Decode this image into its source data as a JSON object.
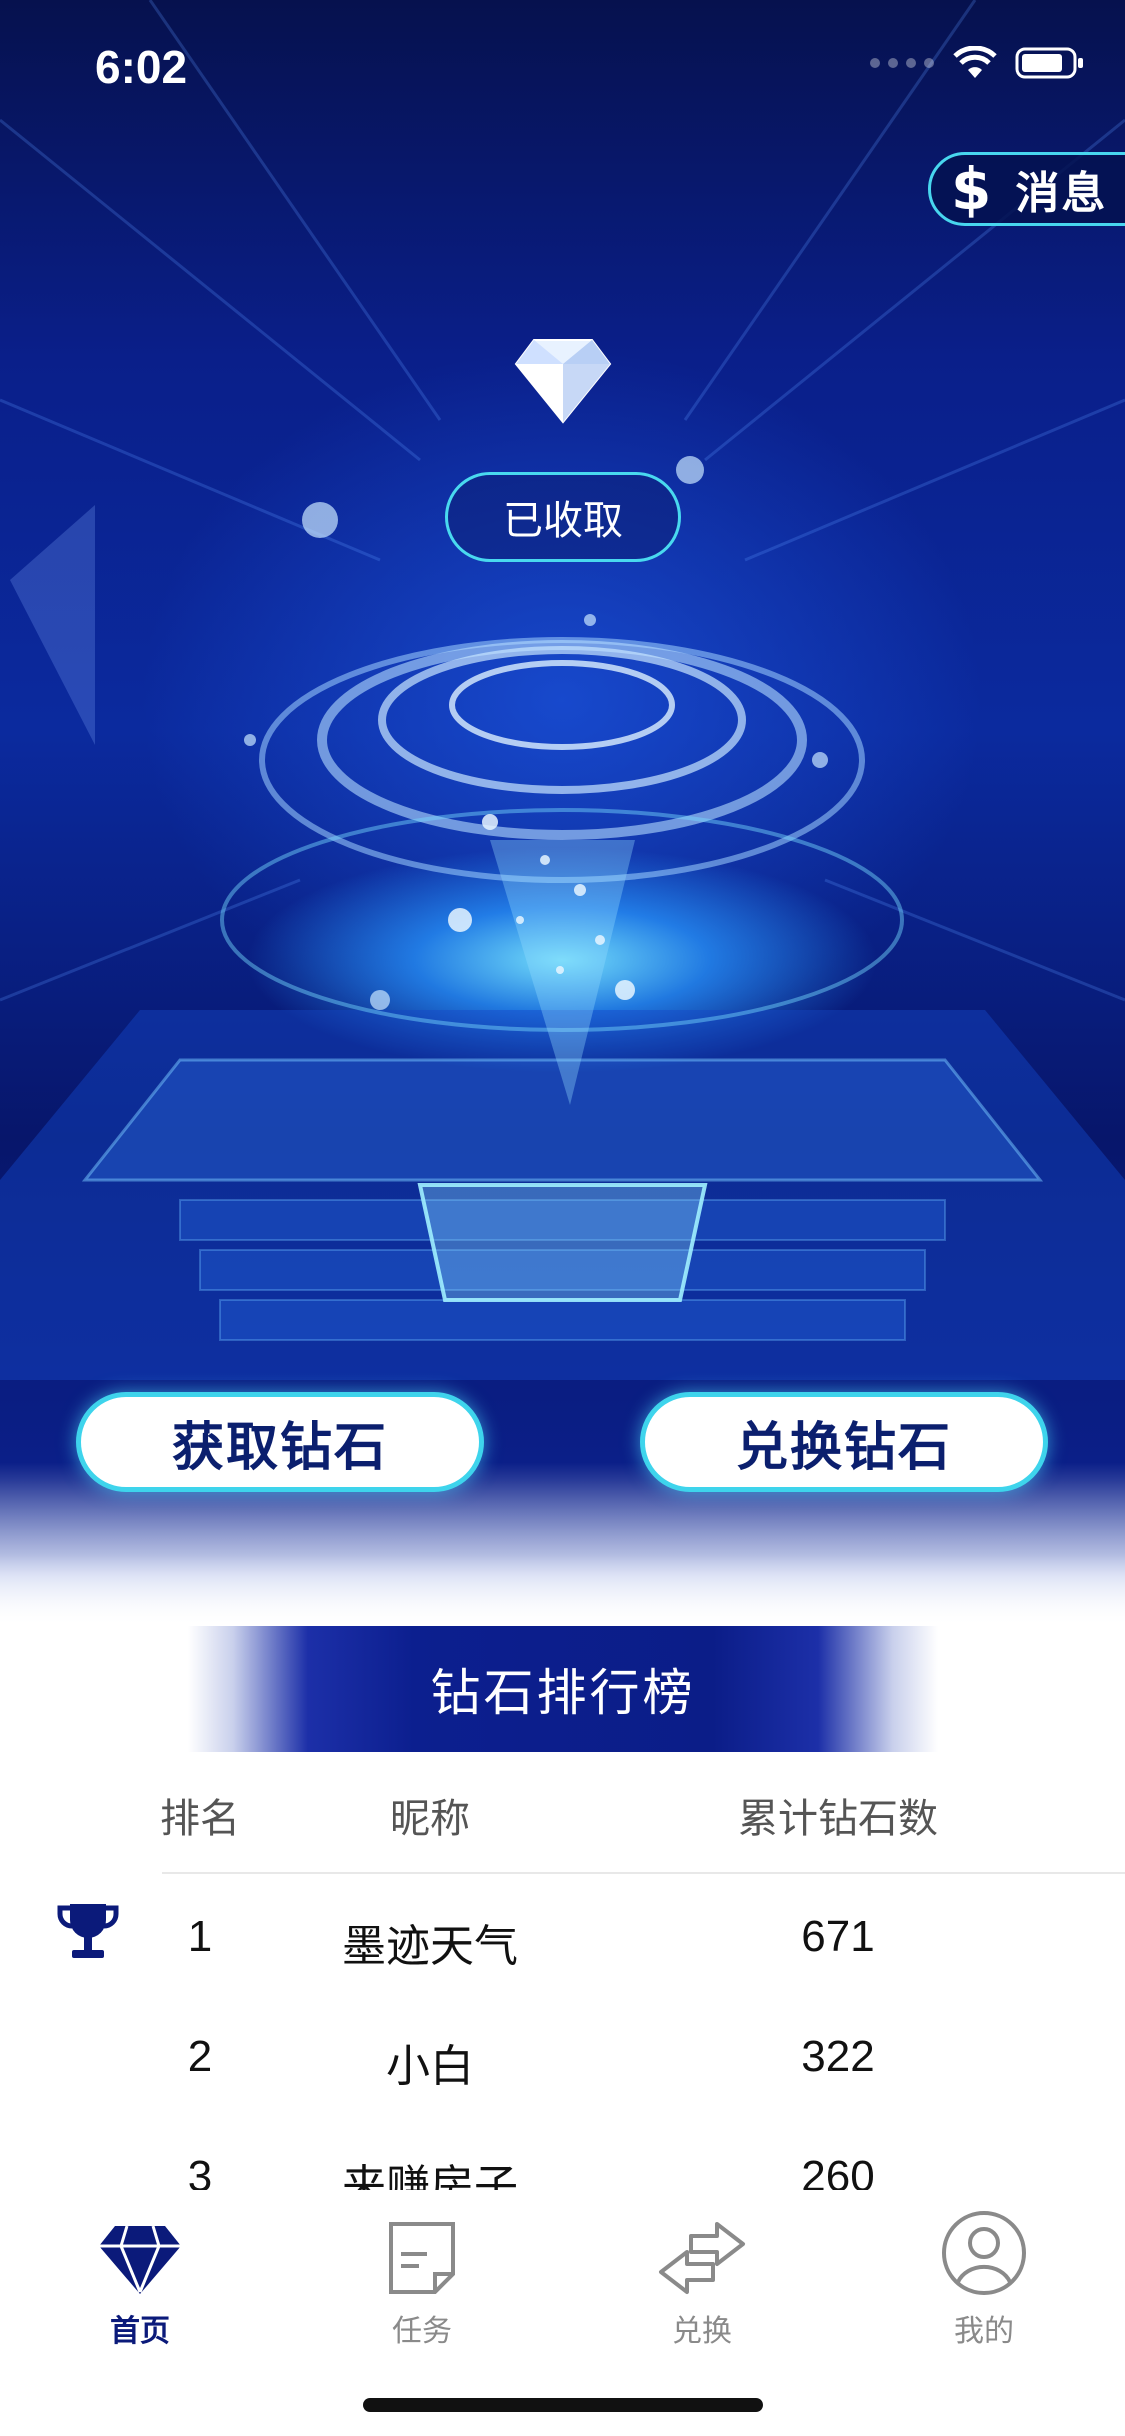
{
  "status_bar": {
    "time": "6:02"
  },
  "header": {
    "message_button": {
      "icon": "dollar-icon",
      "label": "消息"
    }
  },
  "hero": {
    "collected_label": "已收取",
    "get_button": "获取钻石",
    "exchange_button": "兑换钻石"
  },
  "leaderboard": {
    "title": "钻石排行榜",
    "columns": [
      "排名",
      "昵称",
      "累计钻石数"
    ],
    "rows": [
      {
        "rank": "1",
        "name": "墨迹天气",
        "diamonds": "671",
        "icon": "trophy-icon"
      },
      {
        "rank": "2",
        "name": "小白",
        "diamonds": "322"
      },
      {
        "rank": "3",
        "name": "来赚房子",
        "diamonds": "260"
      }
    ]
  },
  "tabbar": {
    "tabs": [
      {
        "label": "首页",
        "icon": "diamond-icon",
        "active": true
      },
      {
        "label": "任务",
        "icon": "document-icon",
        "active": false
      },
      {
        "label": "兑换",
        "icon": "swap-arrows-icon",
        "active": false
      },
      {
        "label": "我的",
        "icon": "profile-icon",
        "active": false
      }
    ]
  },
  "colors": {
    "accent_cyan": "#3ed4ec",
    "brand_navy": "#0b1a7a",
    "active_tab": "#0b1a7a",
    "inactive_tab": "#8a8a8a"
  }
}
